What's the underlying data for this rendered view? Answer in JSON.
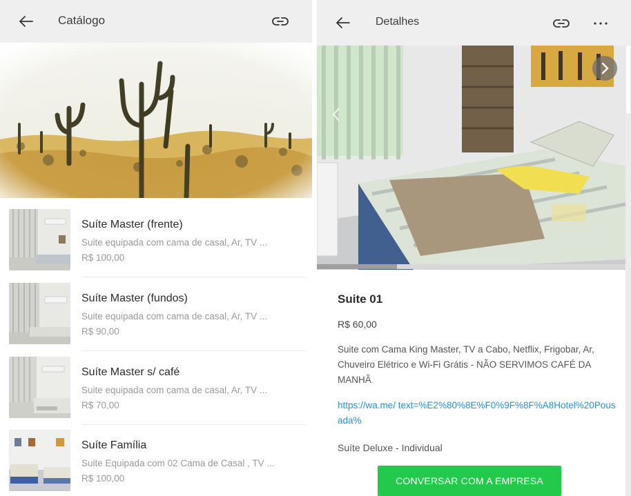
{
  "catalog": {
    "title": "Catálogo",
    "items": [
      {
        "title": "Suíte Master (frente)",
        "description": "Suite equipada com cama de casal, Ar, TV ...",
        "price": "R$ 100,00"
      },
      {
        "title": "Suíte Master (fundos)",
        "description": "Suite equipada com cama de casal, Ar, TV ...",
        "price": "R$ 90,00"
      },
      {
        "title": "Suíte Master s/ café",
        "description": "Suite equipada com cama de casal, Ar, TV ...",
        "price": "R$ 70,00"
      },
      {
        "title": "Suíte Família",
        "description": "Suite Equipada com 02 Cama de Casal , TV ...",
        "price": "R$ 100,00"
      }
    ]
  },
  "details": {
    "title": "Detalhes",
    "product_name": "Suite 01",
    "price": "R$ 60,00",
    "description": "Suite com Cama King Master, TV a Cabo, Netflix, Frigobar, Ar, Chuveiro Elétrico e Wi-Fi Grátis - NÃO SERVIMOS CAFÉ DA MANHÃ",
    "link": "https://wa.me/ text=%E2%80%8E%F0%9F%8F%A8Hotel%20Pousada%",
    "category": "Suíte Deluxe - Individual",
    "cta_label": "CONVERSAR COM A EMPRESA",
    "photo_progress": 0.26
  },
  "icons": {
    "back": "arrow-left-icon",
    "link": "link-icon",
    "more": "more-horizontal-icon",
    "prev": "chevron-left-icon",
    "next": "chevron-right-icon"
  },
  "colors": {
    "topbar": "#efefef",
    "cta": "#22c94a",
    "link": "#2a8fd0"
  }
}
